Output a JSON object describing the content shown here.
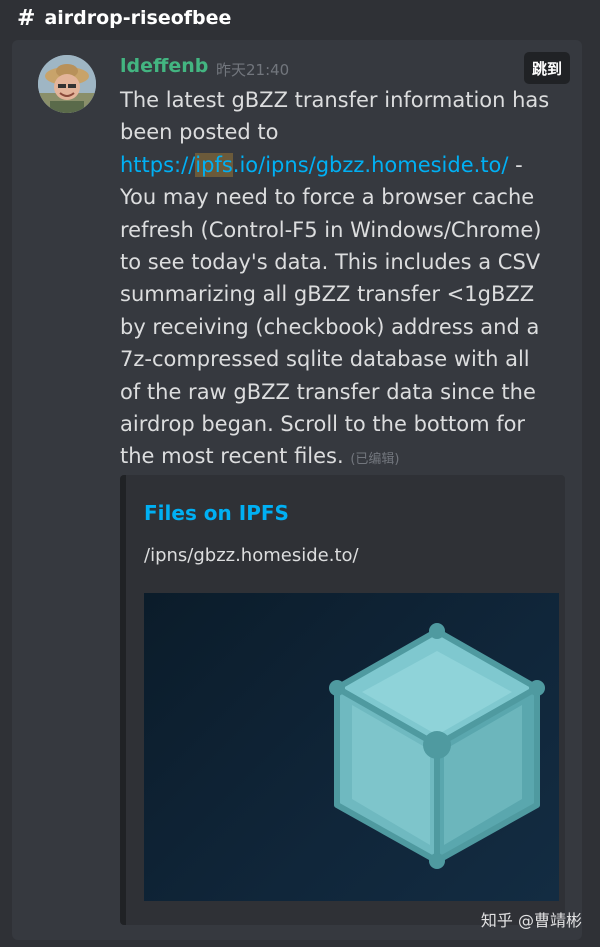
{
  "channel": {
    "hash": "#",
    "name": "airdrop-riseofbee"
  },
  "message": {
    "author": "ldeffenb",
    "timestamp": "昨天21:40",
    "jump_label": "跳到",
    "text_before": "The latest gBZZ transfer information has been posted to ",
    "link_pre": "https://",
    "link_hl": "ipfs",
    "link_post": ".io/ipns/gbzz.homeside.to/",
    "text_after": "  - You may need to force a browser cache refresh (Control-F5 in Windows/Chrome) to see today's data.  This includes a CSV summarizing all gBZZ transfer <1gBZZ by receiving (checkbook) address and a 7z-compressed sqlite database with all of the raw gBZZ transfer data since the airdrop began.  Scroll to the bottom for the most recent files. ",
    "edited": "(已编辑)"
  },
  "embed": {
    "title": "Files on IPFS",
    "description": "/ipns/gbzz.homeside.to/",
    "image_icon": "ipfs-cube-icon"
  },
  "watermark": "知乎 @曹靖彬",
  "colors": {
    "background": "#2f3136",
    "message_bg": "#36393f",
    "author": "#43b581",
    "link": "#00b0f4",
    "cube_face": "#6fb9c0"
  }
}
